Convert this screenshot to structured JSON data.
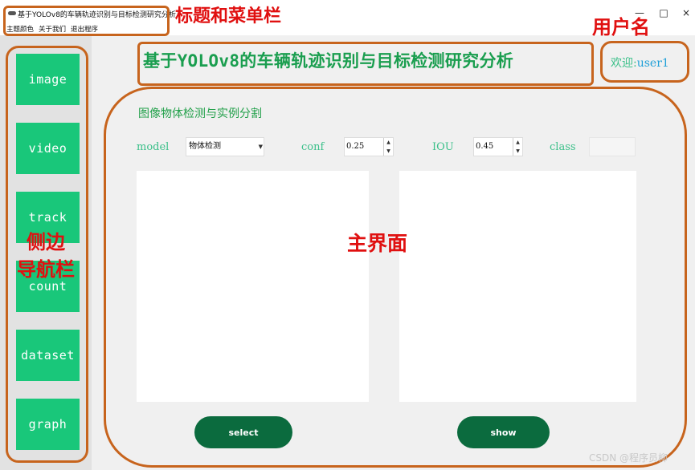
{
  "window": {
    "title": "基于YOLOv8的车辆轨迹识别与目标检测研究分析",
    "controls": {
      "minimize": "—",
      "maximize": "□",
      "close": "×"
    }
  },
  "menu": {
    "items": [
      "主题颜色",
      "关于我们",
      "退出程序"
    ]
  },
  "header": {
    "app_title": "基于YOLOv8的车辆轨迹识别与目标检测研究分析",
    "welcome_label": "欢迎:",
    "username": "user1"
  },
  "sidebar": {
    "items": [
      "image",
      "video",
      "track",
      "count",
      "dataset",
      "graph"
    ]
  },
  "main": {
    "section_title": "图像物体检测与实例分割",
    "model_label": "model",
    "model_value": "物体检测",
    "conf_label": "conf",
    "conf_value": "0.25",
    "iou_label": "IOU",
    "iou_value": "0.45",
    "class_label": "class",
    "class_value": "",
    "select_label": "select",
    "show_label": "show"
  },
  "annotations": {
    "title_menu": "标题和菜单栏",
    "username": "用户名",
    "sidebar_line1": "侧边",
    "sidebar_line2": "导航栏",
    "main": "主界面"
  },
  "watermark": "CSDN @程序员柳",
  "colors": {
    "nav_button": "#19c77a",
    "action_button": "#0b6b3e",
    "title_green": "#1a9e4f",
    "annotation_border": "#c7641d",
    "annotation_text": "#e01010"
  }
}
